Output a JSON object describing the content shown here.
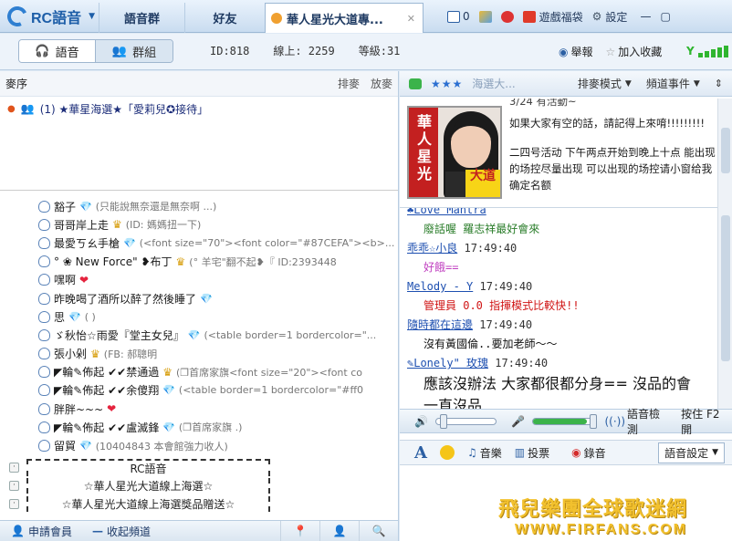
{
  "app": {
    "logo_text": "RC語音"
  },
  "tabs": [
    {
      "label": "語音群"
    },
    {
      "label": "好友"
    },
    {
      "label": "華人星光大道專..."
    }
  ],
  "topright": {
    "mail_count": "0",
    "games_label": "遊戲福袋",
    "settings_label": "設定"
  },
  "modes": {
    "voice": "語音",
    "group": "群組"
  },
  "stats": {
    "id": "ID:818",
    "online": "線上: 2259",
    "level": "等級:31"
  },
  "actions": {
    "report": "舉報",
    "favorite": "加入收藏"
  },
  "queue": {
    "title": "麥序",
    "sort": "排麥",
    "release": "放麥",
    "item": "(1) ★華星海選★「愛莉兒✪接待」"
  },
  "users": [
    {
      "name": "豁子",
      "badge": "gem",
      "sig": "(只能說無奈還是無奈啊 ...)"
    },
    {
      "name": "哥哥岸上走",
      "badge": "crown",
      "sig": "(ID: 媽媽扭一下)"
    },
    {
      "name": "最愛ㄎㄠ手槍",
      "badge": "gem",
      "sig": "(<font size=\"70\"><font color=\"#87CEFA\"><b>..."
    },
    {
      "name": "° ❀ New  Force\" ❥布丁",
      "badge": "crown",
      "sig": "(° 羊宅\"翻不起❥『 ID:2393448"
    },
    {
      "name": "嘿啊",
      "badge": "heart",
      "sig": ""
    },
    {
      "name": "昨晚喝了酒所以醉了然後睡了",
      "badge": "gem",
      "sig": ""
    },
    {
      "name": "思",
      "badge": "gem",
      "sig": "( )"
    },
    {
      "name": "ゞ秋怡☆雨愛『堂主女兒』",
      "badge": "gem",
      "sig": "(<table border=1 bordercolor=\"..."
    },
    {
      "name": "張小剁",
      "badge": "crown",
      "sig": "(FB: 郝聰明"
    },
    {
      "name": "◤輪✎佈起 ✔✔禁通過",
      "badge": "crown",
      "sig": "(❐首席家旗<font size=\"20\"><font co"
    },
    {
      "name": "◤輪✎佈起 ✔✔余傻翔",
      "badge": "gem",
      "sig": "(<table border=1 bordercolor=\"#ff0"
    },
    {
      "name": "胖胖~~~",
      "badge": "heart",
      "sig": ""
    },
    {
      "name": "◤輪✎佈起 ✔✔盧滅鋒",
      "badge": "gem",
      "sig": "(❐首席家旗 .)"
    },
    {
      "name": "留貿",
      "badge": "gem",
      "sig": "(10404843 本會館強力收人)"
    }
  ],
  "sections": {
    "rc_voice": "RC語音",
    "channel1": "☆華人星光大道線上海選☆",
    "channel2": "☆華人星光大道線上海選獎品贈送☆"
  },
  "left_footer": {
    "apply_member": "申請會員",
    "collapse_channel": "收起頻道"
  },
  "right_header": {
    "stars": "★★★",
    "channel": "海選大...",
    "queue_mode": "排麥模式",
    "channel_events": "頻道事件"
  },
  "poster": {
    "text_vertical": "華人星光",
    "text_badge": "大道"
  },
  "announcement": [
    "3/24 有活動~",
    "如果大家有空的話，請記得上來唷!!!!!!!!!",
    "二四号活动 下午两点开始到晚上十点 能出现的场控尽量出现 可以出现的场控请小窗给我确定名额"
  ],
  "chat": [
    {
      "name": "♣Love  Mantra",
      "time": "",
      "msg": "廢話喔 羅志祥最好會來",
      "msg_color": "#2a7d2a"
    },
    {
      "name": "乖乖☆小良",
      "time": "17:49:40",
      "msg": "好餓==",
      "msg_color": "#c040c0"
    },
    {
      "name": "Melody - Y",
      "time": "17:49:40",
      "msg": "管理員 0.0  指揮模式比較快!!",
      "msg_color": "#d01515"
    },
    {
      "name": "隨時都在這邊",
      "time": "17:49:40",
      "msg": "沒有黃國倫..要加老師～～",
      "msg_color": "#111111"
    },
    {
      "name": "✎Lonely\" 玫瑰",
      "time": "17:49:40",
      "msg": "應該沒辦法 大家都很都分身== 沒品的會一直沒品",
      "msg_color": "#111111"
    }
  ],
  "audio": {
    "detect": "語音檢測",
    "ptt": "按住 F2 開"
  },
  "toolbar": {
    "music": "音樂",
    "vote": "投票",
    "record": "錄音",
    "voice_settings": "語音設定"
  },
  "watermark": {
    "line1": "飛兒樂團全球歌迷網",
    "line2": "WWW.FIRFANS.COM"
  },
  "colors": {
    "accent": "#2f7fd1",
    "online_green": "#2fb52f",
    "poster_red": "#c32020"
  }
}
